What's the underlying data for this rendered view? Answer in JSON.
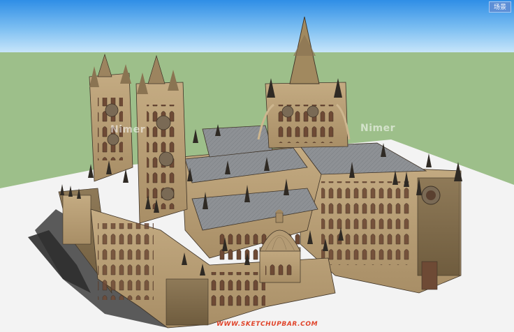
{
  "scene": {
    "tab_label": "场景"
  },
  "model": {
    "name_icon": "cathedral-model",
    "colors": {
      "sky_top": "#2f8ee6",
      "ground_green": "#9dbf8a",
      "ground_white": "#f5f5f5",
      "stone": "#b39a72",
      "stone_dark": "#7f6a48",
      "roof": "#8f9296",
      "window": "#6e4a35"
    }
  },
  "watermarks": {
    "left": "Nimer",
    "right": "Nimer",
    "site": "WWW.SKETCHUPBAR.COM"
  }
}
